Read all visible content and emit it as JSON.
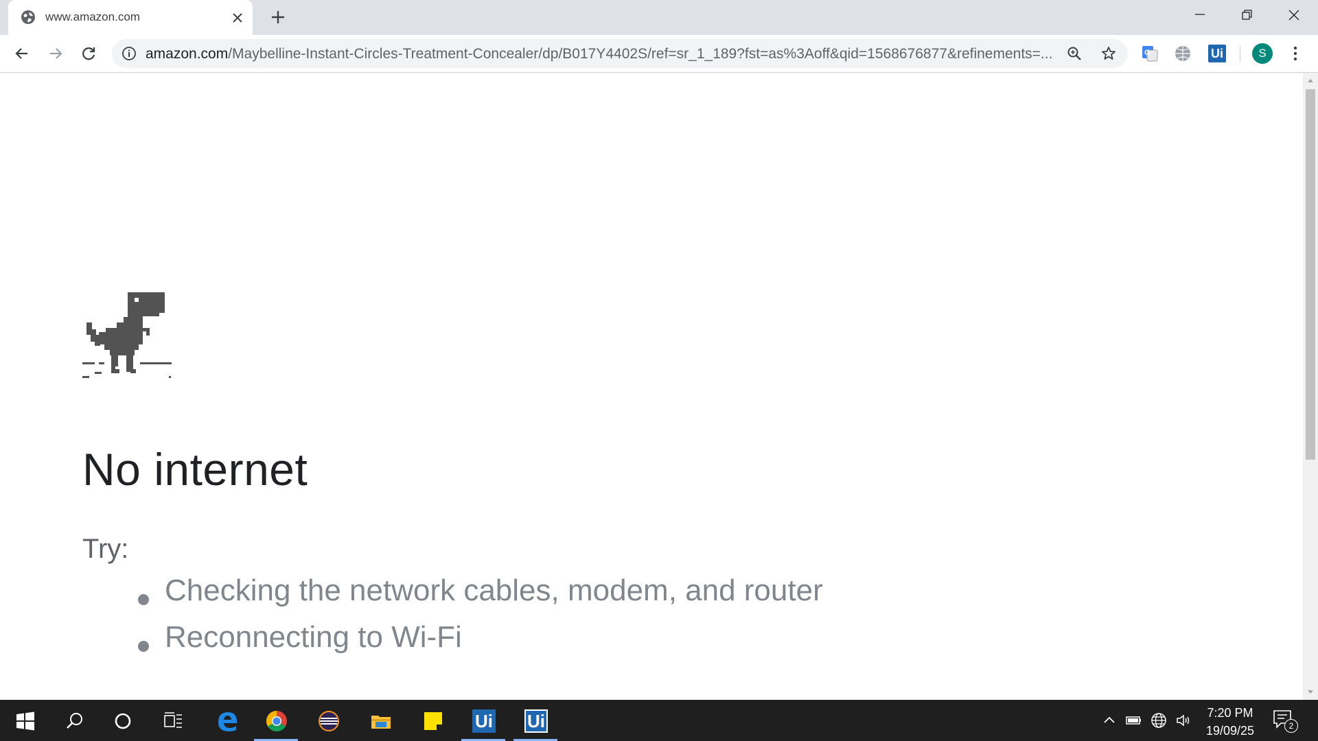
{
  "browser": {
    "tab": {
      "title": "www.amazon.com",
      "favicon": "globe-icon"
    },
    "window_controls": [
      "minimize-icon",
      "restore-icon",
      "close-icon"
    ],
    "url": {
      "host": "amazon.com",
      "path": "/Maybelline-Instant-Circles-Treatment-Concealer/dp/B017Y4402S/ref=sr_1_189?fst=as%3Aoff&qid=1568676877&refinements=..."
    },
    "extensions": [
      "google-translate-icon",
      "globe-extension-icon",
      "uipath-extension-icon"
    ],
    "uipath_ext_label": "Ui",
    "profile_initial": "S",
    "profile_color": "#00897b"
  },
  "page": {
    "heading": "No internet",
    "try_label": "Try:",
    "suggestions": [
      "Checking the network cables, modem, and router",
      "Reconnecting to Wi-Fi"
    ]
  },
  "taskbar": {
    "apps": [
      "start-icon",
      "search-icon",
      "cortana-icon",
      "task-view-icon",
      "edge-icon",
      "chrome-icon",
      "eclipse-icon",
      "file-explorer-icon",
      "sticky-notes-icon",
      "uipath-studio-icon",
      "uipath-robot-icon"
    ],
    "uipath_label": "Ui",
    "time": "7:20 PM",
    "date": "19/09/25",
    "notification_count": "2"
  }
}
